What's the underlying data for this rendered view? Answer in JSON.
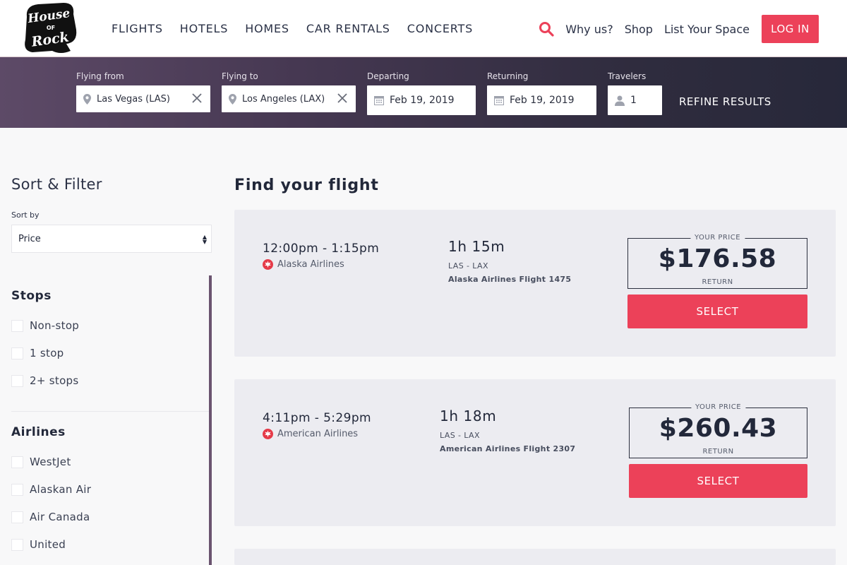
{
  "header": {
    "logo_text": "House of Rock",
    "nav": [
      "FLIGHTS",
      "HOTELS",
      "HOMES",
      "CAR RENTALS",
      "CONCERTS"
    ],
    "why_us": "Why us?",
    "shop": "Shop",
    "list_space": "List Your Space",
    "login": "LOG IN",
    "accent_color": "#ec4159"
  },
  "search": {
    "from_label": "Flying from",
    "from_value": "Las Vegas (LAS)",
    "to_label": "Flying to",
    "to_value": "Los Angeles (LAX)",
    "depart_label": "Departing",
    "depart_value": "Feb 19, 2019",
    "return_label": "Returning",
    "return_value": "Feb 19, 2019",
    "travelers_label": "Travelers",
    "travelers_value": "1",
    "refine": "REFINE RESULTS"
  },
  "sidebar": {
    "title": "Sort & Filter",
    "sort_label": "Sort by",
    "sort_value": "Price",
    "stops_title": "Stops",
    "stops": [
      "Non-stop",
      "1 stop",
      "2+ stops"
    ],
    "airlines_title": "Airlines",
    "airlines": [
      "WestJet",
      "Alaskan Air",
      "Air Canada",
      "United"
    ]
  },
  "main": {
    "title": "Find your flight",
    "flights": [
      {
        "times": "12:00pm - 1:15pm",
        "airline": "Alaska Airlines",
        "duration": "1h 15m",
        "route": "LAS - LAX",
        "flight": "Alaska Airlines Flight 1475",
        "price_label": "YOUR PRICE",
        "price": "$176.58",
        "price_note": "RETURN",
        "select": "SELECT"
      },
      {
        "times": "4:11pm - 5:29pm",
        "airline": "American Airlines",
        "duration": "1h 18m",
        "route": "LAS - LAX",
        "flight": "American Airlines Flight 2307",
        "price_label": "YOUR PRICE",
        "price": "$260.43",
        "price_note": "RETURN",
        "select": "SELECT"
      }
    ]
  }
}
